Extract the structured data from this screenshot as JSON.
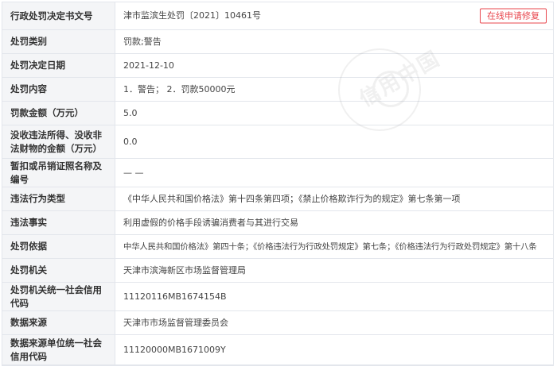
{
  "record": {
    "rows": [
      {
        "label": "行政处罚决定书文号",
        "value": "津市监滨生处罚〔2021〕10461号"
      },
      {
        "label": "处罚类别",
        "value": "罚款;警告"
      },
      {
        "label": "处罚决定日期",
        "value": "2021-12-10"
      },
      {
        "label": "处罚内容",
        "value": "1．警告； 2．罚款50000元"
      },
      {
        "label": "罚款金额（万元）",
        "value": "5.0"
      },
      {
        "label": "没收违法所得、没收非法财物的金额（万元）",
        "value": "0.0"
      },
      {
        "label": "暂扣或吊销证照名称及编号",
        "value": "— —"
      },
      {
        "label": "违法行为类型",
        "value": "《中华人民共和国价格法》第十四条第四项；《禁止价格欺诈行为的规定》第七条第一项"
      },
      {
        "label": "违法事实",
        "value": "利用虚假的价格手段诱骗消费者与其进行交易"
      },
      {
        "label": "处罚依据",
        "value": "中华人民共和国价格法》第四十条；《价格违法行为行政处罚规定》第七条；《价格违法行为行政处罚规定》第十八条"
      },
      {
        "label": "处罚机关",
        "value": "天津市滨海新区市场监督管理局"
      },
      {
        "label": "处罚机关统一社会信用代码",
        "value": "11120116MB1674154B"
      },
      {
        "label": "数据来源",
        "value": "天津市市场监督管理委员会"
      },
      {
        "label": "数据来源单位统一社会信用代码",
        "value": "11120000MB1671009Y"
      }
    ]
  },
  "actions": {
    "repair_button": "在线申请修复"
  },
  "watermark": {
    "text": "信用中国"
  }
}
